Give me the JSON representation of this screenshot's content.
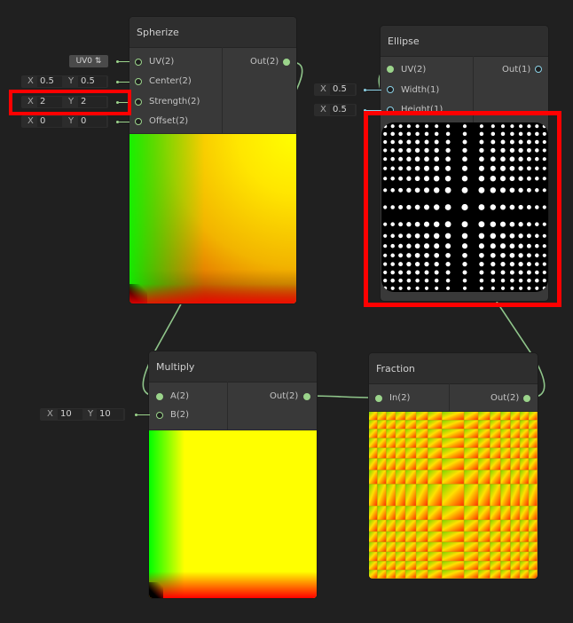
{
  "nodes": {
    "spherize": {
      "title": "Spherize",
      "inputs": [
        "UV(2)",
        "Center(2)",
        "Strength(2)",
        "Offset(2)"
      ],
      "output": "Out(2)",
      "uv_dropdown": "UV0 ⇅",
      "center": {
        "x_label": "X",
        "x": "0.5",
        "y_label": "Y",
        "y": "0.5"
      },
      "strength": {
        "x_label": "X",
        "x": "2",
        "y_label": "Y",
        "y": "2"
      },
      "offset": {
        "x_label": "X",
        "x": "0",
        "y_label": "Y",
        "y": "0"
      }
    },
    "ellipse": {
      "title": "Ellipse",
      "inputs": [
        "UV(2)",
        "Width(1)",
        "Height(1)"
      ],
      "output": "Out(1)",
      "width": {
        "x_label": "X",
        "x": "0.5"
      },
      "height": {
        "x_label": "X",
        "x": "0.5"
      }
    },
    "multiply": {
      "title": "Multiply",
      "inputs": [
        "A(2)",
        "B(2)"
      ],
      "output": "Out(2)",
      "b": {
        "x_label": "X",
        "x": "10",
        "y_label": "Y",
        "y": "10"
      }
    },
    "fraction": {
      "title": "Fraction",
      "inputs": [
        "In(2)"
      ],
      "output": "Out(2)"
    }
  },
  "colors": {
    "highlight": "#ff0000",
    "wire": "#8fc58a",
    "wire_cyan": "#8bd1e6",
    "background": "#202020",
    "node": "#393939"
  },
  "icons": [
    "port-connector-icon",
    "dropdown-arrows-icon"
  ]
}
